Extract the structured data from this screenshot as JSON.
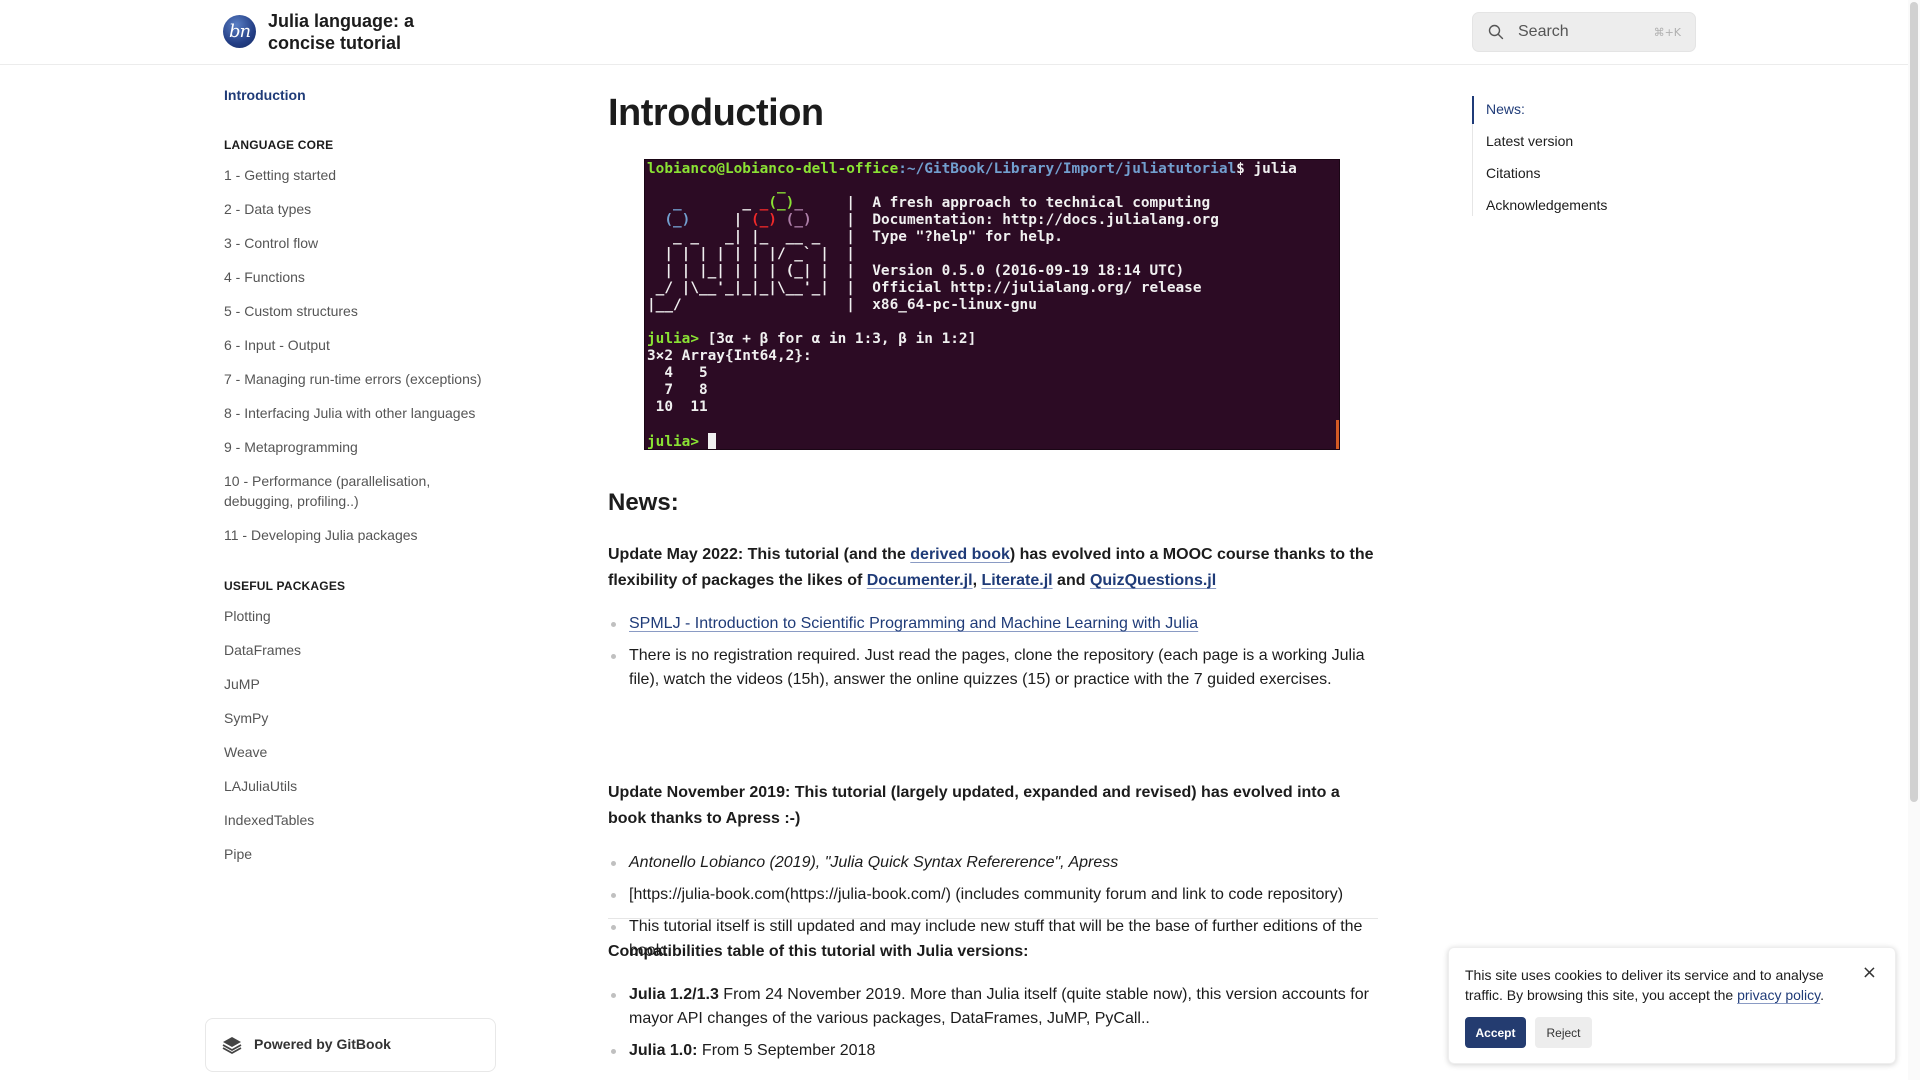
{
  "header": {
    "logo_text": "bn",
    "site_title": "Julia language: a concise tutorial",
    "search_placeholder": "Search",
    "search_shortcut": "⌘+K"
  },
  "sidebar": {
    "intro": "Introduction",
    "sections": [
      {
        "title": "LANGUAGE CORE",
        "items": [
          "1 - Getting started",
          "2 - Data types",
          "3 - Control flow",
          "4 - Functions",
          "5 - Custom structures",
          "6 - Input - Output",
          "7 - Managing run-time errors (exceptions)",
          "8 - Interfacing Julia with other languages",
          "9 - Metaprogramming",
          "10 - Performance (parallelisation, debugging, profiling..)",
          "11 - Developing Julia packages"
        ]
      },
      {
        "title": "USEFUL PACKAGES",
        "items": [
          "Plotting",
          "DataFrames",
          "JuMP",
          "SymPy",
          "Weave",
          "LAJuliaUtils",
          "IndexedTables",
          "Pipe"
        ]
      }
    ],
    "powered_by": "Powered by GitBook"
  },
  "main": {
    "title": "Introduction",
    "terminal": {
      "prompt_user": "lobianco@Lobianco-dell-office",
      "prompt_path": ":~/GitBook/Library/Import/juliatutorial",
      "prompt_cmd": "$ julia",
      "banner_lines": [
        "A fresh approach to technical computing",
        "Documentation: http://docs.julialang.org",
        "Type \"?help\" for help.",
        "",
        "Version 0.5.0 (2016-09-19 18:14 UTC)",
        "Official http://julialang.org/ release",
        "x86_64-pc-linux-gnu"
      ],
      "repl_prompt": "julia>",
      "input": " [3α + β for α in 1:3, β in 1:2]",
      "output_lines": [
        "3×2 Array{Int64,2}:",
        "  4   5",
        "  7   8",
        " 10  11"
      ]
    },
    "news_heading": "News:",
    "update_2022": {
      "prefix": "Update May 2022: This tutorial (and the ",
      "link_derived": "derived book",
      "mid": ") has evolved into a MOOC course thanks to the flexibility of packages the likes of ",
      "link_documenter": "Documenter.jl",
      "comma": ", ",
      "link_literate": "Literate.jl",
      "and": " and ",
      "link_quiz": "QuizQuestions.jl"
    },
    "list_2022": {
      "link_spmlj": "SPMLJ - Introduction to Scientific Programming and Machine Learning with Julia",
      "no_registration": "There is no registration required. Just read the pages, clone the repository (each page is a working Julia file), watch the videos (15h), answer the online quizzes (15) or practice with the 7 guided exercises."
    },
    "update_2019": "Update November 2019: This tutorial (largely updated, expanded and revised) has evolved into a book thanks to Apress :-)",
    "list_2019": [
      "Antonello Lobianco (2019), \"Julia Quick Syntax Refererence\", Apress",
      "[https://julia-book.com(https://julia-book.com/) (includes community forum and link to code repository)",
      "This tutorial itself is still updated and may include new stuff that will be the base of further editions of the book."
    ],
    "compat_heading": "Compatibilities table of this tutorial with Julia versions:",
    "compat_list": [
      {
        "version": "Julia 1.2/1.3",
        "text": " From 24 November 2019. More than Julia itself (quite stable now), this version accounts for mayor API changes of the various packages, DataFrames, JuMP, PyCall.."
      },
      {
        "version": "Julia 1.0:",
        "text": " From 5 September 2018"
      }
    ]
  },
  "toc": {
    "items": [
      "News:",
      "Latest version",
      "Citations",
      "Acknowledgements"
    ],
    "active_index": 0
  },
  "cookie": {
    "text": "This site uses cookies to deliver its service and to analyse traffic. By browsing this site, you accept the ",
    "link": "privacy policy",
    "end": ".",
    "accept": "Accept",
    "reject": "Reject",
    "close_icon": "×"
  },
  "colors": {
    "accent": "#1f3b78",
    "terminal_bg": "#2c0b24",
    "accept_button": "#243c70"
  }
}
